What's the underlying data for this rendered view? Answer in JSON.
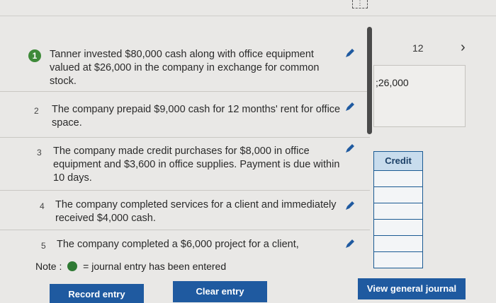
{
  "header": {
    "expand_icon": "dashed-expand-icon"
  },
  "pagination": {
    "page": "12",
    "next_label": "›"
  },
  "transactions": [
    {
      "num": "1",
      "text": "Tanner invested $80,000 cash along with office equipment valued at $26,000 in the company in exchange for common stock.",
      "done": true
    },
    {
      "num": "2",
      "text": "The company prepaid $9,000 cash for 12 months' rent for office space.",
      "done": false
    },
    {
      "num": "3",
      "text": "The company made credit purchases for $8,000 in office equipment and $3,600 in office supplies. Payment is due within 10 days.",
      "done": false
    },
    {
      "num": "4",
      "text": "The company completed services for a client and immediately received $4,000 cash.",
      "done": false
    },
    {
      "num": "5",
      "text": "The company completed a $6,000 project for a client,",
      "done": false
    }
  ],
  "amount_partial": ";26,000",
  "credit_header": "Credit",
  "note": {
    "prefix": "Note :",
    "suffix": "= journal entry has been entered"
  },
  "buttons": {
    "record": "Record entry",
    "clear": "Clear entry",
    "view": "View general journal"
  },
  "colors": {
    "accent": "#1f5aa0",
    "done": "#3e8a39"
  }
}
